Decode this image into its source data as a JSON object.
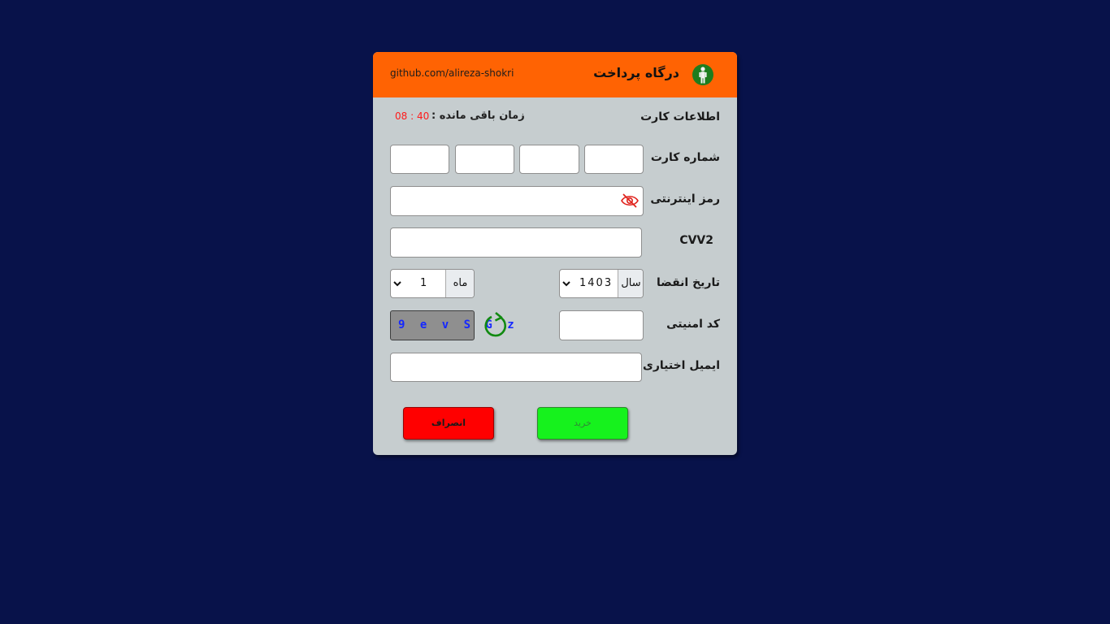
{
  "header": {
    "title": "درگاه پرداخت",
    "github_link": "github.com/alireza-shokri",
    "logo_icon": "person-icon"
  },
  "section": {
    "card_info_label": "اطلاعات کارت",
    "timer_label": "زمان باقی مانده :",
    "timer_value": "08 : 40"
  },
  "form": {
    "card_number_label": "شماره کارت",
    "internet_password_label": "رمز اینترنتی",
    "cvv2_label": "CVV2",
    "expiry_label": "تاریخ انقضا",
    "year_addon": "سال",
    "year_value": "1403",
    "month_addon": "ماه",
    "month_value": "1",
    "security_code_label": "کد امنیتی",
    "captcha_text": "9 e v S G z",
    "email_label": "ایمیل اختیاری"
  },
  "buttons": {
    "buy_label": "خرید",
    "cancel_label": "انصراف"
  },
  "colors": {
    "background": "#08124a",
    "header": "#ff6303",
    "card": "#c6cdcf",
    "buy": "#16f21d",
    "cancel": "#ff0000",
    "timer": "#ff1a1a",
    "captcha_text": "#1528ff"
  }
}
